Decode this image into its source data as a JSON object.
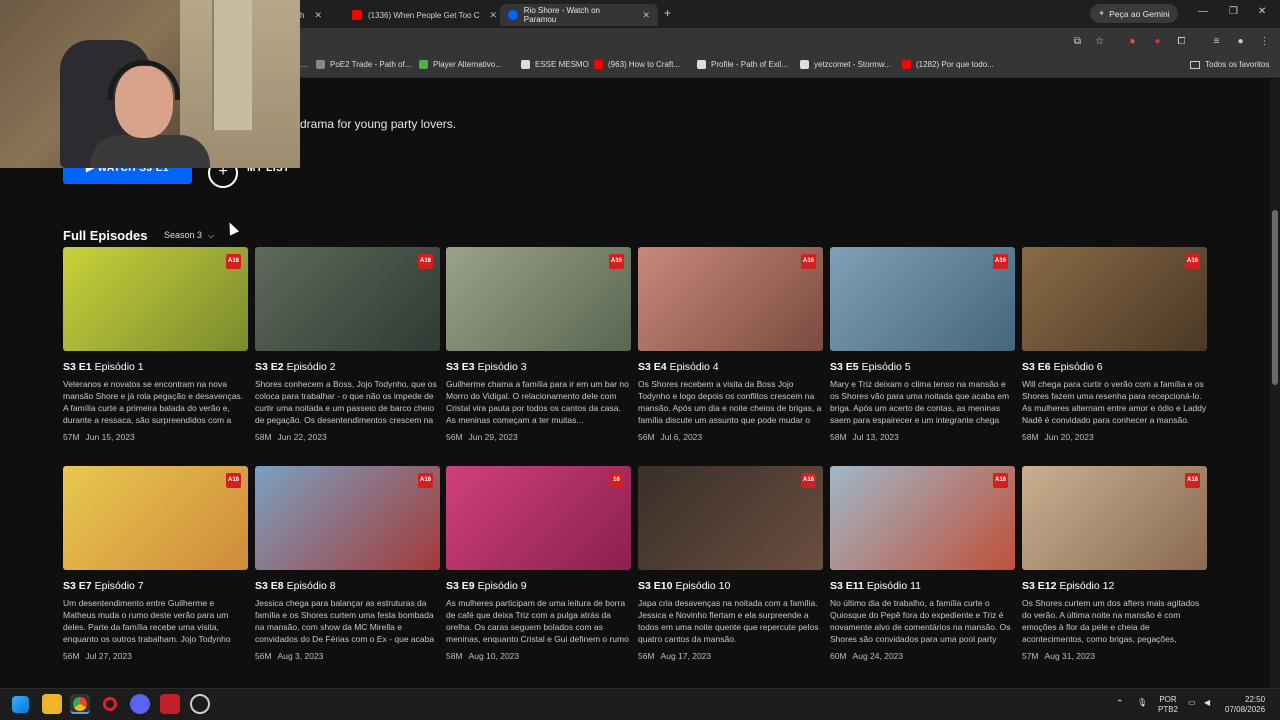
{
  "browser": {
    "tabs": [
      {
        "title": "h",
        "active": false,
        "color": "#ff4444"
      },
      {
        "title": "(1336) When People Get Too C",
        "active": false,
        "color": "#ff0000"
      },
      {
        "title": "Rio Shore - Watch on Paramou",
        "active": true,
        "color": "#0064ff"
      }
    ],
    "new_tab": "+",
    "gemini_label": "Peça ao Gemini",
    "bookmarks": [
      {
        "label": "PoE2 Trade - Path of...",
        "color": "#888"
      },
      {
        "label": "Player Alternativo...",
        "color": "#4caf50"
      },
      {
        "label": "ESSE MESMO",
        "color": "#ddd"
      },
      {
        "label": "(963) How to Craft...",
        "color": "#ff0000"
      },
      {
        "label": "Profile - Path of Exil...",
        "color": "#ddd"
      },
      {
        "label": "yetzcomet - Stormw...",
        "color": "#ddd"
      },
      {
        "label": "(1282) Por que todo...",
        "color": "#ff0000"
      }
    ],
    "all_favorites": "Todos os favoritos"
  },
  "show": {
    "tagline_fragment": "drama for young party lovers.",
    "watch_label": "▶ WATCH S3 E1",
    "mylist_label": "MY LIST",
    "mylist_icon": "plus-icon"
  },
  "episodes_section": {
    "title": "Full Episodes",
    "season_label": "Season 3",
    "episodes": [
      {
        "code": "S3 E1",
        "title": "Episódio 1",
        "desc": "Veteranos e novatos se encontram na nova mansão Shore e já rola pegação e desavenças. A família curte a primeira balada do verão e, durante a ressaca, são surpreendidos com a chegada da...",
        "duration": "57M",
        "date": "Jun 15, 2023",
        "rating": "A16",
        "thumb": [
          "#c9d23a",
          "#7a8a2e"
        ]
      },
      {
        "code": "S3 E2",
        "title": "Episódio 2",
        "desc": "Shores conhecem a Boss, Jojo Todynho, que os coloca para trabalhar - o que não os impede de curtir uma noitada e um passeio de barco cheio de pegação. Os desentendimentos crescem na família...",
        "duration": "58M",
        "date": "Jun 22, 2023",
        "rating": "A16",
        "thumb": [
          "#5e6a5a",
          "#2f3a34"
        ]
      },
      {
        "code": "S3 E3",
        "title": "Episódio 3",
        "desc": "Guilherme chama a família para ir em um bar no Morro do Vidigal. O relacionamento dele com Cristal vira pauta por todos os cantos da casa. As meninas começam a ter muitas...",
        "duration": "56M",
        "date": "Jun 29, 2023",
        "rating": "A16",
        "thumb": [
          "#9aa38a",
          "#5a6650"
        ]
      },
      {
        "code": "S3 E4",
        "title": "Episódio 4",
        "desc": "Os Shores recebem a visita da Boss Jojo Todynho e logo depois os conflitos crescem na mansão. Após um dia e noite cheios de brigas, a família discute um assunto que pode mudar o rumo do...",
        "duration": "56M",
        "date": "Jul 6, 2023",
        "rating": "A16",
        "thumb": [
          "#c8897a",
          "#7b4a40"
        ]
      },
      {
        "code": "S3 E5",
        "title": "Episódio 5",
        "desc": "Mary e Triz deixam o clima tenso na mansão e os Shores vão para uma noitada que acaba em briga. Após um acerto de contas, as meninas saem para espairecer e um integrante chega na...",
        "duration": "58M",
        "date": "Jul 13, 2023",
        "rating": "A16",
        "thumb": [
          "#7fa0b8",
          "#45667a"
        ]
      },
      {
        "code": "S3 E6",
        "title": "Episódio 6",
        "desc": "Will chega para curtir o verão com a família e os Shores fazem uma resenha para recepcioná-lo. As mulheres alternam entre amor e ódio e Laddy Nadê é convidado para conhecer a mansão.",
        "duration": "58M",
        "date": "Jun 20, 2023",
        "rating": "A16",
        "thumb": [
          "#8a6a45",
          "#4a3826"
        ]
      },
      {
        "code": "S3 E7",
        "title": "Episódio 7",
        "desc": "Um desentendimento entre Guilherme e Matheus muda o rumo deste verão para um deles. Parte da família recebe uma visita, enquanto os outros trabalham. Jojo Todynho aparece com planos...",
        "duration": "56M",
        "date": "Jul 27, 2023",
        "rating": "A16",
        "thumb": [
          "#e8c850",
          "#d08a3a"
        ]
      },
      {
        "code": "S3 E8",
        "title": "Episódio 8",
        "desc": "Jessica chega para balançar as estruturas da família e os Shores curtem uma festa bombada na mansão, com show da MC Mirella e convidados do De Férias com o Ex - que acaba em pegaçã...",
        "duration": "56M",
        "date": "Aug 3, 2023",
        "rating": "A16",
        "thumb": [
          "#7aa0c0",
          "#a33a3a"
        ]
      },
      {
        "code": "S3 E9",
        "title": "Episódio 9",
        "desc": "As mulheres participam de uma leitura de borra de café que deixa Triz com a pulga atrás da orelha. Os caras seguem bolados com as meninas, enquanto Cristal e Gui definem o rumo da relação.",
        "duration": "58M",
        "date": "Aug 10, 2023",
        "rating": "16",
        "thumb": [
          "#d0407a",
          "#8a2050"
        ]
      },
      {
        "code": "S3 E10",
        "title": "Episódio 10",
        "desc": "Japa cria desavenças na noitada com a família. Jessica e Novinho flertam e ela surpreende a todos em uma noite quente que repercute pelos quatro cantos da mansão.",
        "duration": "56M",
        "date": "Aug 17, 2023",
        "rating": "A16",
        "thumb": [
          "#3a2f2a",
          "#6a4e3e"
        ]
      },
      {
        "code": "S3 E11",
        "title": "Episódio 11",
        "desc": "No último dia de trabalho, a família curte o Quiosque do Pepê fora do expediente e Triz é novamente alvo de comentários na mansão. Os Shores são convidados para uma pool party muito animada!",
        "duration": "60M",
        "date": "Aug 24, 2023",
        "rating": "A16",
        "thumb": [
          "#a0b8c8",
          "#c0503a"
        ]
      },
      {
        "code": "S3 E12",
        "title": "Episódio 12",
        "desc": "Os Shores curtem um dos afters mais agitados do verão. A última noite na mansão é com emoções à flor da pele e cheia de acontecimentos, como brigas, pegações, reconciliações e até pedido d...",
        "duration": "57M",
        "date": "Aug 31, 2023",
        "rating": "A16",
        "thumb": [
          "#c8b090",
          "#8a6a50"
        ]
      }
    ]
  },
  "taskbar": {
    "lang_top": "POR",
    "lang_bottom": "PTB2",
    "time": "22:50",
    "date": "07/08/2026"
  },
  "colors": {
    "accent": "#0064ff",
    "badge": "#d31f1f",
    "background": "#0f0f0f"
  }
}
